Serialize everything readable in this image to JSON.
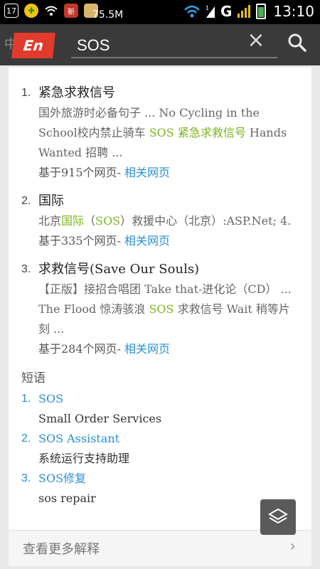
{
  "status": {
    "speed": "75.5M",
    "time": "13:10",
    "sim_label": "1",
    "net_label": "G"
  },
  "header": {
    "badge": "En",
    "badge_mark": "中",
    "query": "SOS"
  },
  "results": [
    {
      "num": "1.",
      "title": "紧急求救信号",
      "snippet_1": "国外旅游时必备句子 ... No Cycling in the School校内禁止骑车 ",
      "snippet_hl": "SOS 紧急求救信号",
      "snippet_2": " Hands Wanted 招聘 ...",
      "meta": "基于915个网页- ",
      "link": "相关网页"
    },
    {
      "num": "2.",
      "title": "国际",
      "snippet_1": "北京",
      "snippet_hl": "国际",
      "snippet_mid": "（",
      "snippet_hl2": "SOS",
      "snippet_2": "）救援中心（北京）:ASP.Net; 4.",
      "meta": "基于335个网页- ",
      "link": "相关网页"
    },
    {
      "num": "3.",
      "title": "求救信号(Save Our Souls)",
      "snippet_1": "【正版】接招合唱团 Take that-进化论（CD） ... The Flood 惊涛骇浪 ",
      "snippet_hl": "SOS",
      "snippet_2": " 求救信号 Wait 稍等片刻 ...",
      "meta": "基于284个网页- ",
      "link": "相关网页"
    }
  ],
  "phrases_section": "短语",
  "phrases": [
    {
      "num": "1.",
      "term": "SOS",
      "translation": "Small Order Services"
    },
    {
      "num": "2.",
      "term": "SOS Assistant",
      "translation": "系统运行支持助理"
    },
    {
      "num": "3.",
      "term": "SOS修复",
      "translation": "sos repair"
    }
  ],
  "more": {
    "label": "查看更多解释",
    "arrow": "›"
  },
  "colors": {
    "accent_red": "#e23b2e",
    "link_blue": "#2a8fd6",
    "highlight_green": "#7ab51d"
  }
}
